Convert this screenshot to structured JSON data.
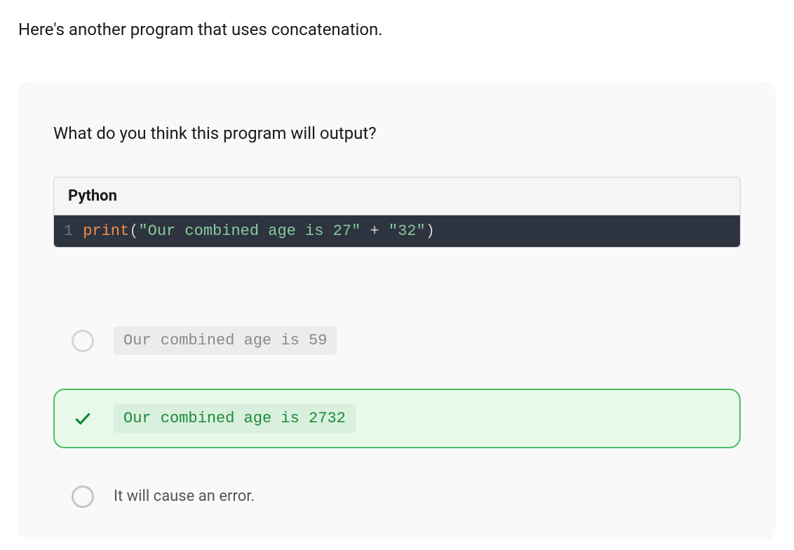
{
  "intro": "Here's another program that uses concatenation.",
  "question": "What do you think this program will output?",
  "code": {
    "language": "Python",
    "line_number": "1",
    "tokens": {
      "fn": "print",
      "open_paren": "(",
      "str1": "\"Our combined age is 27\"",
      "op": " + ",
      "str2": "\"32\"",
      "close_paren": ")"
    }
  },
  "options": [
    {
      "label": "Our combined age is 59",
      "mono": true,
      "state": "faded"
    },
    {
      "label": "Our combined age is 2732",
      "mono": true,
      "state": "correct"
    },
    {
      "label": "It will cause an error.",
      "mono": false,
      "state": "plain"
    }
  ]
}
